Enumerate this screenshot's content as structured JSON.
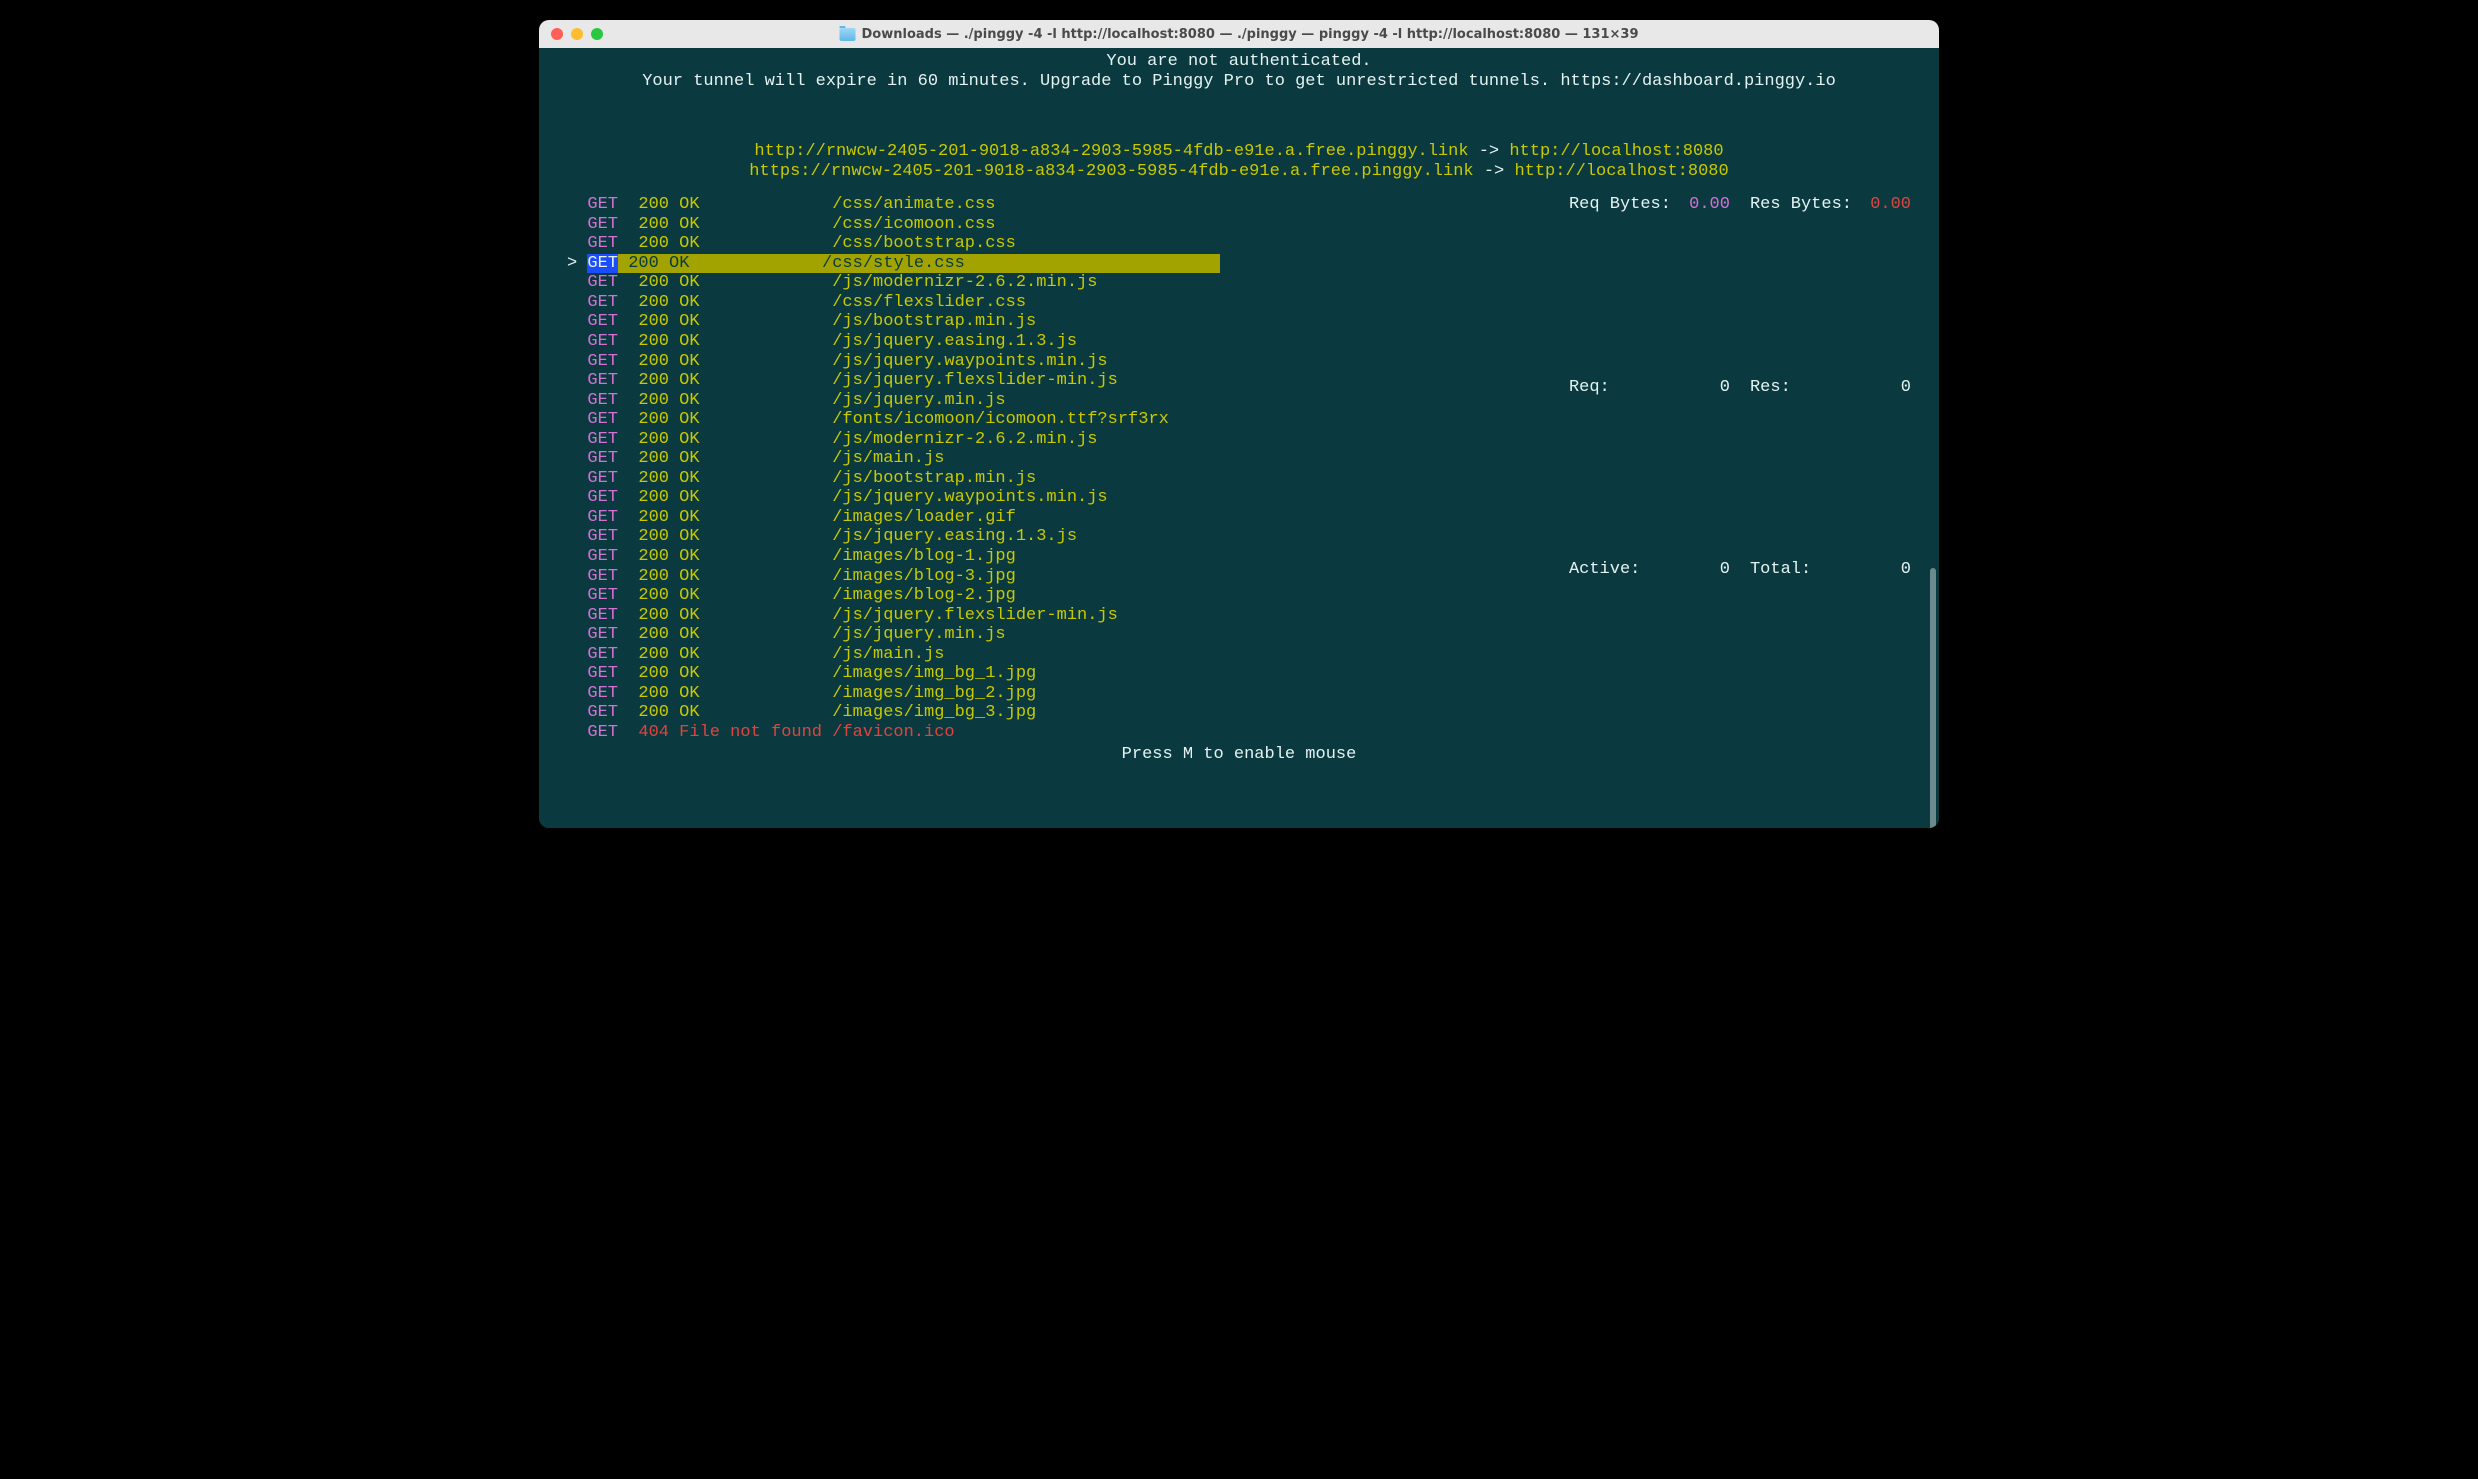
{
  "window": {
    "title": "Downloads — ./pinggy -4 -l http://localhost:8080 — ./pinggy — pinggy -4 -l http://localhost:8080 — 131×39"
  },
  "banner": {
    "line1": "You are not authenticated.",
    "line2": "Your tunnel will expire in 60 minutes. Upgrade to Pinggy Pro to get unrestricted tunnels. https://dashboard.pinggy.io"
  },
  "tunnels": [
    {
      "public": "http://rnwcw-2405-201-9018-a834-2903-5985-4fdb-e91e.a.free.pinggy.link",
      "arrow": " -> ",
      "local": "http://localhost:8080"
    },
    {
      "public": "https://rnwcw-2405-201-9018-a834-2903-5985-4fdb-e91e.a.free.pinggy.link",
      "arrow": " -> ",
      "local": "http://localhost:8080"
    }
  ],
  "stats": {
    "req_bytes_label": "Req Bytes:",
    "req_bytes_value": "0.00",
    "res_bytes_label": "Res Bytes:",
    "res_bytes_value": "0.00",
    "req_label": "Req:",
    "req_value": "0",
    "res_label": "Res:",
    "res_value": "0",
    "active_label": "Active:",
    "active_value": "0",
    "total_label": "Total:",
    "total_value": "0"
  },
  "requests": [
    {
      "marker": "  ",
      "method": "GET",
      "code": "200",
      "status": "OK",
      "path": "/css/animate.css",
      "selected": false
    },
    {
      "marker": "  ",
      "method": "GET",
      "code": "200",
      "status": "OK",
      "path": "/css/icomoon.css",
      "selected": false
    },
    {
      "marker": "  ",
      "method": "GET",
      "code": "200",
      "status": "OK",
      "path": "/css/bootstrap.css",
      "selected": false
    },
    {
      "marker": "> ",
      "method": "GET",
      "code": "200",
      "status": "OK",
      "path": "/css/style.css",
      "selected": true
    },
    {
      "marker": "  ",
      "method": "GET",
      "code": "200",
      "status": "OK",
      "path": "/js/modernizr-2.6.2.min.js",
      "selected": false
    },
    {
      "marker": "  ",
      "method": "GET",
      "code": "200",
      "status": "OK",
      "path": "/css/flexslider.css",
      "selected": false
    },
    {
      "marker": "  ",
      "method": "GET",
      "code": "200",
      "status": "OK",
      "path": "/js/bootstrap.min.js",
      "selected": false
    },
    {
      "marker": "  ",
      "method": "GET",
      "code": "200",
      "status": "OK",
      "path": "/js/jquery.easing.1.3.js",
      "selected": false
    },
    {
      "marker": "  ",
      "method": "GET",
      "code": "200",
      "status": "OK",
      "path": "/js/jquery.waypoints.min.js",
      "selected": false
    },
    {
      "marker": "  ",
      "method": "GET",
      "code": "200",
      "status": "OK",
      "path": "/js/jquery.flexslider-min.js",
      "selected": false
    },
    {
      "marker": "  ",
      "method": "GET",
      "code": "200",
      "status": "OK",
      "path": "/js/jquery.min.js",
      "selected": false
    },
    {
      "marker": "  ",
      "method": "GET",
      "code": "200",
      "status": "OK",
      "path": "/fonts/icomoon/icomoon.ttf?srf3rx",
      "selected": false
    },
    {
      "marker": "  ",
      "method": "GET",
      "code": "200",
      "status": "OK",
      "path": "/js/modernizr-2.6.2.min.js",
      "selected": false
    },
    {
      "marker": "  ",
      "method": "GET",
      "code": "200",
      "status": "OK",
      "path": "/js/main.js",
      "selected": false
    },
    {
      "marker": "  ",
      "method": "GET",
      "code": "200",
      "status": "OK",
      "path": "/js/bootstrap.min.js",
      "selected": false
    },
    {
      "marker": "  ",
      "method": "GET",
      "code": "200",
      "status": "OK",
      "path": "/js/jquery.waypoints.min.js",
      "selected": false
    },
    {
      "marker": "  ",
      "method": "GET",
      "code": "200",
      "status": "OK",
      "path": "/images/loader.gif",
      "selected": false
    },
    {
      "marker": "  ",
      "method": "GET",
      "code": "200",
      "status": "OK",
      "path": "/js/jquery.easing.1.3.js",
      "selected": false
    },
    {
      "marker": "  ",
      "method": "GET",
      "code": "200",
      "status": "OK",
      "path": "/images/blog-1.jpg",
      "selected": false
    },
    {
      "marker": "  ",
      "method": "GET",
      "code": "200",
      "status": "OK",
      "path": "/images/blog-3.jpg",
      "selected": false
    },
    {
      "marker": "  ",
      "method": "GET",
      "code": "200",
      "status": "OK",
      "path": "/images/blog-2.jpg",
      "selected": false
    },
    {
      "marker": "  ",
      "method": "GET",
      "code": "200",
      "status": "OK",
      "path": "/js/jquery.flexslider-min.js",
      "selected": false
    },
    {
      "marker": "  ",
      "method": "GET",
      "code": "200",
      "status": "OK",
      "path": "/js/jquery.min.js",
      "selected": false
    },
    {
      "marker": "  ",
      "method": "GET",
      "code": "200",
      "status": "OK",
      "path": "/js/main.js",
      "selected": false
    },
    {
      "marker": "  ",
      "method": "GET",
      "code": "200",
      "status": "OK",
      "path": "/images/img_bg_1.jpg",
      "selected": false
    },
    {
      "marker": "  ",
      "method": "GET",
      "code": "200",
      "status": "OK",
      "path": "/images/img_bg_2.jpg",
      "selected": false
    },
    {
      "marker": "  ",
      "method": "GET",
      "code": "200",
      "status": "OK",
      "path": "/images/img_bg_3.jpg",
      "selected": false
    },
    {
      "marker": "  ",
      "method": "GET",
      "code": "404",
      "status": "File not found",
      "path": "/favicon.ico",
      "selected": false
    }
  ],
  "footer": "Press M to enable mouse"
}
